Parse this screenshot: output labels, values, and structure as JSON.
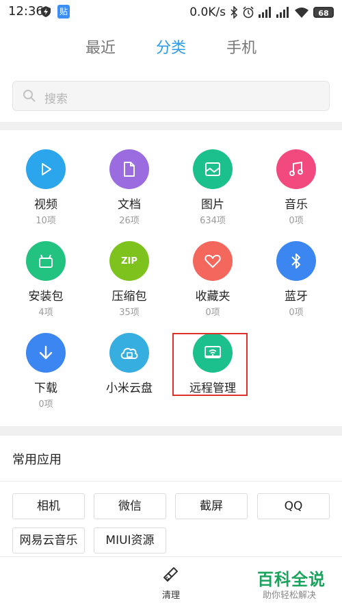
{
  "status_bar": {
    "time": "12:36",
    "badge_char": "贴",
    "net_speed": "0.0K/s",
    "battery": "68"
  },
  "tabs": [
    {
      "label": "最近",
      "active": false
    },
    {
      "label": "分类",
      "active": true
    },
    {
      "label": "手机",
      "active": false
    }
  ],
  "search": {
    "placeholder": "搜索"
  },
  "categories": [
    {
      "name": "视频",
      "count": "10项",
      "icon": "play-icon",
      "color": "#2ba5ec"
    },
    {
      "name": "文档",
      "count": "26项",
      "icon": "document-icon",
      "color": "#9b6be0"
    },
    {
      "name": "图片",
      "count": "634项",
      "icon": "image-icon",
      "color": "#1cc08d"
    },
    {
      "name": "音乐",
      "count": "0项",
      "icon": "music-icon",
      "color": "#f2497f"
    },
    {
      "name": "安装包",
      "count": "4项",
      "icon": "android-icon",
      "color": "#22c380"
    },
    {
      "name": "压缩包",
      "count": "35项",
      "icon": "zip-icon",
      "color": "#7ec31d",
      "icon_text": "ZIP"
    },
    {
      "name": "收藏夹",
      "count": "0项",
      "icon": "heart-icon",
      "color": "#f4675c"
    },
    {
      "name": "蓝牙",
      "count": "0项",
      "icon": "bluetooth-icon",
      "color": "#3b86f0"
    },
    {
      "name": "下载",
      "count": "0项",
      "icon": "download-icon",
      "color": "#3b86f0"
    },
    {
      "name": "小米云盘",
      "count": "",
      "icon": "cloud-icon",
      "color": "#36aee0"
    },
    {
      "name": "远程管理",
      "count": "",
      "icon": "remote-icon",
      "color": "#1cc08d"
    }
  ],
  "common_apps": {
    "title": "常用应用",
    "items": [
      "相机",
      "微信",
      "截屏",
      "QQ",
      "网易云音乐",
      "MIUI资源"
    ]
  },
  "bottom": {
    "clean_label": "清理"
  },
  "watermark": {
    "main": "百科全说",
    "sub": "助你轻松解决"
  }
}
